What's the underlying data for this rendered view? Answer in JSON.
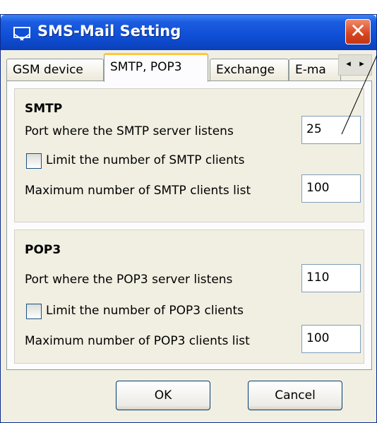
{
  "window": {
    "title": "SMS-Mail Setting",
    "title_icon": "envelope-icon",
    "close_glyph": "✕"
  },
  "tabs": [
    {
      "label": "GSM device"
    },
    {
      "label": "SMTP, POP3",
      "active": true
    },
    {
      "label": "Exchange"
    },
    {
      "label": "E-ma"
    }
  ],
  "tab_scroll": {
    "left": "◂",
    "right": "▸"
  },
  "smtp": {
    "title": "SMTP",
    "port_label": "Port where the SMTP server listens",
    "port_value": "25",
    "limit_label": "Limit the number of SMTP clients",
    "limit_checked": false,
    "max_label": "Maximum number of SMTP clients list",
    "max_value": "100"
  },
  "pop3": {
    "title": "POP3",
    "port_label": "Port where the POP3 server listens",
    "port_value": "110",
    "limit_label": "Limit the number of POP3 clients",
    "limit_checked": false,
    "max_label": "Maximum number of POP3 clients list",
    "max_value": "100"
  },
  "buttons": {
    "ok": "OK",
    "cancel": "Cancel"
  }
}
